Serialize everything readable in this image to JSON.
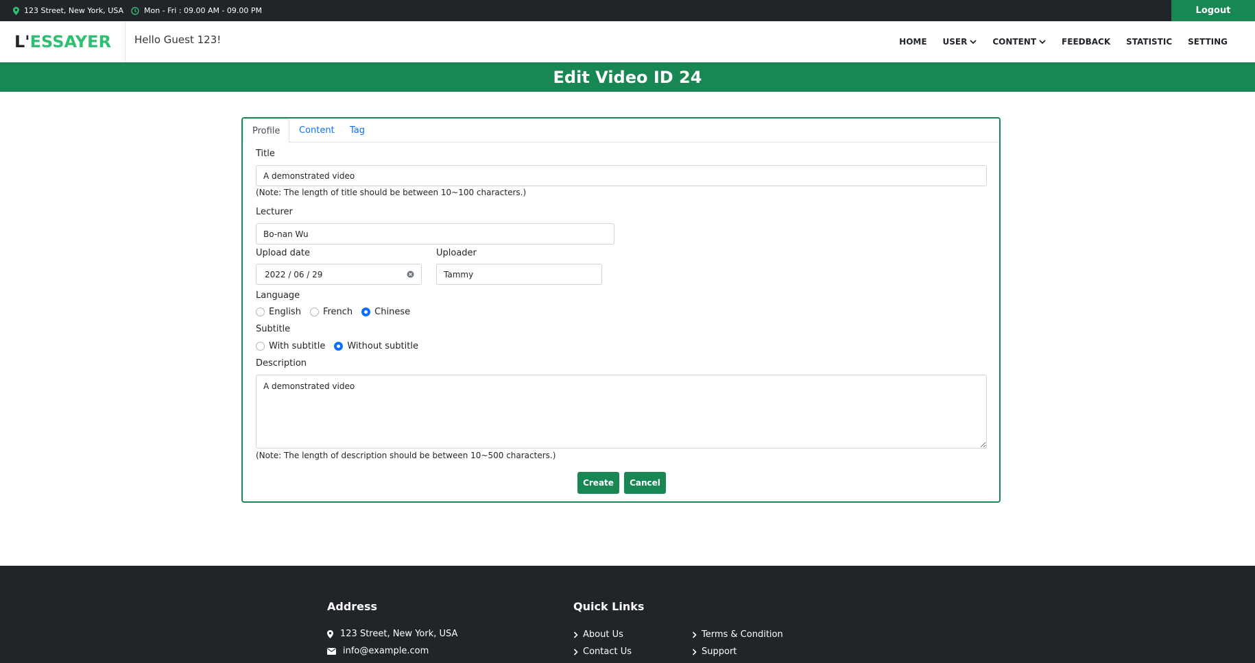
{
  "topbar": {
    "address": "123 Street, New York, USA",
    "hours": "Mon - Fri : 09.00 AM - 09.00 PM",
    "logout_label": "Logout"
  },
  "header": {
    "logo_prefix": "L'",
    "logo_suffix": "ESSAYER",
    "greeting": "Hello Guest 123!",
    "nav": [
      "HOME",
      "USER",
      "CONTENT",
      "FEEDBACK",
      "STATISTIC",
      "SETTING"
    ]
  },
  "page": {
    "title": "Edit Video ID 24"
  },
  "tabs": [
    "Profile",
    "Content",
    "Tag"
  ],
  "form": {
    "title_label": "Title",
    "title_value": "A demonstrated video",
    "title_note": "(Note: The length of title should be between 10~100 characters.)",
    "lecturer_label": "Lecturer",
    "lecturer_value": "Bo-nan Wu",
    "upload_date_label": "Upload date",
    "upload_date_value": "2022 / 06 / 29",
    "uploader_label": "Uploader",
    "uploader_value": "Tammy",
    "language_label": "Language",
    "language_options": [
      "English",
      "French",
      "Chinese"
    ],
    "language_selected": "Chinese",
    "subtitle_label": "Subtitle",
    "subtitle_options": [
      "With subtitle",
      "Without subtitle"
    ],
    "subtitle_selected": "Without subtitle",
    "description_label": "Description",
    "description_value": "A demonstrated video",
    "description_note": "(Note: The length of description should be between 10~500 characters.)",
    "create_label": "Create",
    "cancel_label": "Cancel"
  },
  "footer": {
    "address_title": "Address",
    "address": "123 Street, New York, USA",
    "email": "info@example.com",
    "quick_links_title": "Quick Links",
    "links": [
      "About Us",
      "Contact Us",
      "Terms & Condition",
      "Support"
    ]
  },
  "colors": {
    "primary_green": "#198754",
    "logo_green": "#2fbf71",
    "dark": "#212529",
    "link_blue": "#0d6efd"
  }
}
